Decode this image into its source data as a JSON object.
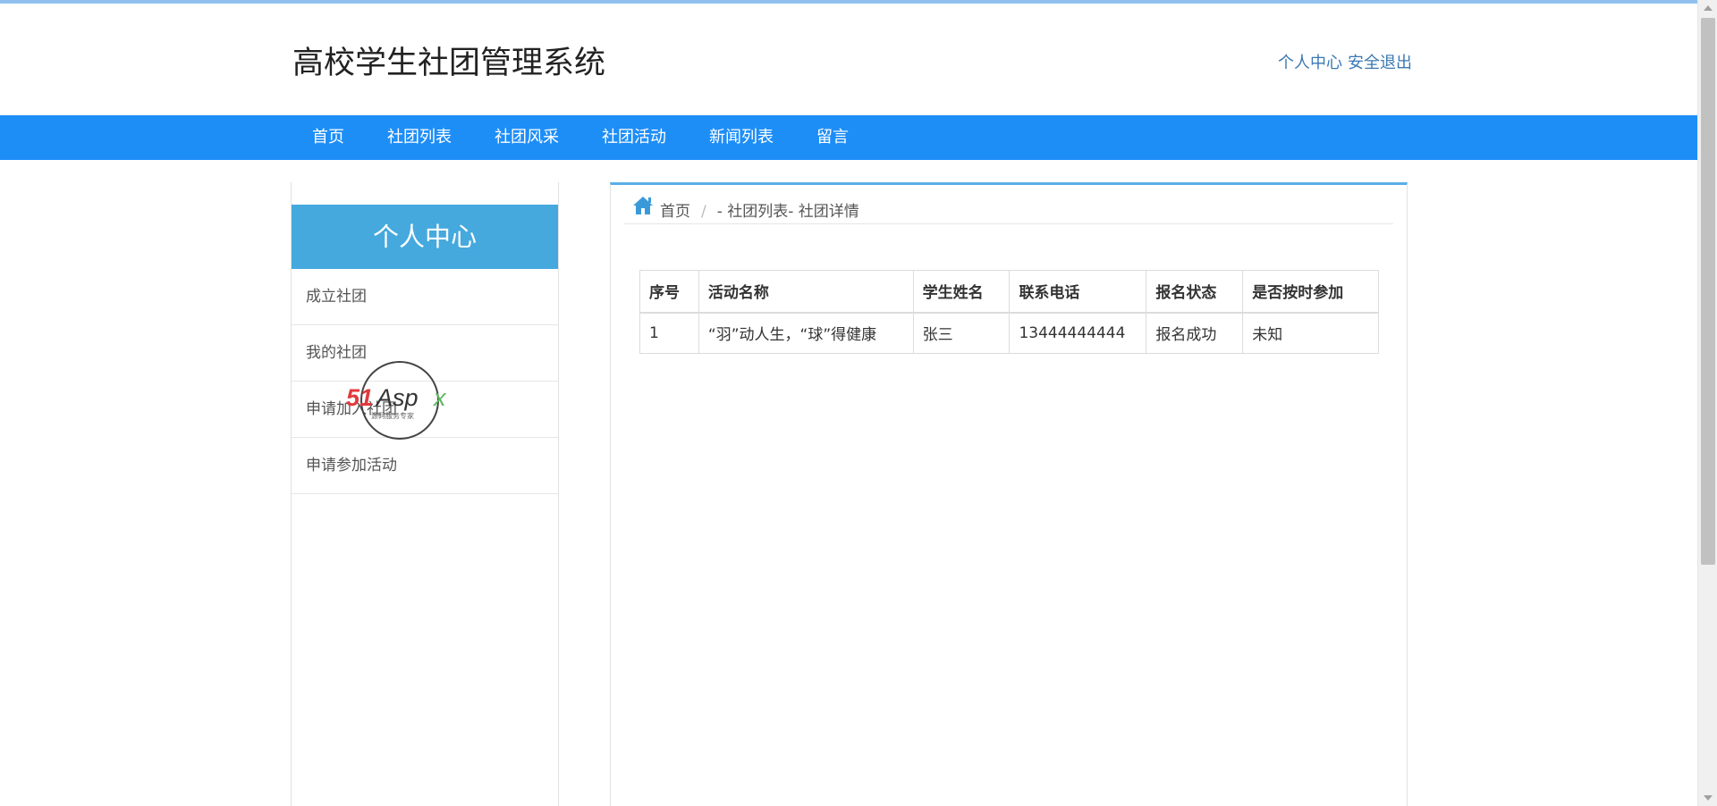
{
  "header": {
    "title": "高校学生社团管理系统",
    "links": [
      "个人中心",
      "安全退出"
    ]
  },
  "nav": {
    "items": [
      "首页",
      "社团列表",
      "社团风采",
      "社团活动",
      "新闻列表",
      "留言"
    ]
  },
  "sidebar": {
    "title": "个人中心",
    "items": [
      "成立社团",
      "我的社团",
      "申请加入社团",
      "申请参加活动"
    ]
  },
  "watermark": {
    "brand": "51Aspx",
    "tagline": "源码服务专家"
  },
  "breadcrumb": {
    "home": "首页",
    "separator": "/",
    "current": "- 社团列表- 社团详情"
  },
  "table": {
    "headers": [
      "序号",
      "活动名称",
      "学生姓名",
      "联系电话",
      "报名状态",
      "是否按时参加"
    ],
    "rows": [
      [
        "1",
        "“羽”动人生，“球”得健康",
        "张三",
        "13444444444",
        "报名成功",
        "未知"
      ]
    ]
  },
  "colors": {
    "nav_bg": "#1e8ef7",
    "sidebar_header_bg": "#45a9de",
    "link": "#3a78b3",
    "panel_top_border": "#5aaee8"
  },
  "icons": [
    "home-icon",
    "scroll-up-arrow-icon",
    "scroll-down-arrow-icon"
  ]
}
